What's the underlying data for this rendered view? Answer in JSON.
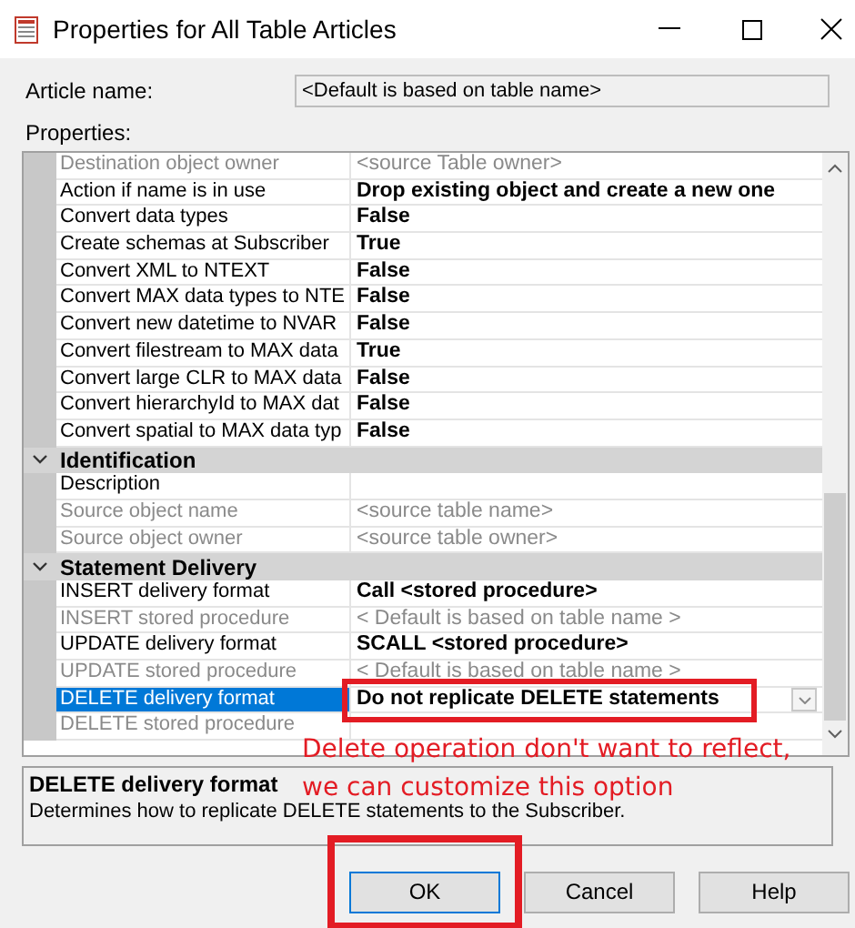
{
  "window": {
    "title": "Properties for All Table Articles"
  },
  "article_name": {
    "label": "Article name:",
    "value": "<Default is based on table name>"
  },
  "properties_label": "Properties:",
  "grid": {
    "rows": [
      {
        "kind": "property",
        "name": "Destination object owner",
        "value": "<source Table owner>",
        "readonly": true,
        "modified": false,
        "selected": false,
        "highlighted": false
      },
      {
        "kind": "property",
        "name": "Action if name is in use",
        "value": "Drop existing object and create a new one",
        "readonly": false,
        "modified": true,
        "selected": false,
        "highlighted": false
      },
      {
        "kind": "property",
        "name": "Convert data types",
        "value": "False",
        "readonly": false,
        "modified": true,
        "selected": false,
        "highlighted": false
      },
      {
        "kind": "property",
        "name": "Create schemas at Subscriber",
        "value": "True",
        "readonly": false,
        "modified": true,
        "selected": false,
        "highlighted": false
      },
      {
        "kind": "property",
        "name": "Convert XML to NTEXT",
        "value": "False",
        "readonly": false,
        "modified": true,
        "selected": false,
        "highlighted": false
      },
      {
        "kind": "property",
        "name": "Convert MAX data types to NTE",
        "value": "False",
        "readonly": false,
        "modified": true,
        "selected": false,
        "highlighted": false
      },
      {
        "kind": "property",
        "name": "Convert new datetime to NVAR",
        "value": "False",
        "readonly": false,
        "modified": true,
        "selected": false,
        "highlighted": false
      },
      {
        "kind": "property",
        "name": "Convert filestream to MAX data",
        "value": "True",
        "readonly": false,
        "modified": true,
        "selected": false,
        "highlighted": false
      },
      {
        "kind": "property",
        "name": "Convert large CLR to MAX data",
        "value": "False",
        "readonly": false,
        "modified": true,
        "selected": false,
        "highlighted": false
      },
      {
        "kind": "property",
        "name": "Convert hierarchyId to MAX dat",
        "value": "False",
        "readonly": false,
        "modified": true,
        "selected": false,
        "highlighted": false
      },
      {
        "kind": "property",
        "name": "Convert spatial to MAX data typ",
        "value": "False",
        "readonly": false,
        "modified": true,
        "selected": false,
        "highlighted": false
      },
      {
        "kind": "category",
        "label": "Identification",
        "expanded": true
      },
      {
        "kind": "property",
        "name": "Description",
        "readonly": false,
        "selected": false,
        "highlighted": false
      },
      {
        "kind": "property",
        "name": "Source object name",
        "value": "<source table name>",
        "readonly": true,
        "modified": false,
        "selected": false,
        "highlighted": false
      },
      {
        "kind": "property",
        "name": "Source object owner",
        "value": "<source table owner>",
        "readonly": true,
        "modified": false,
        "selected": false,
        "highlighted": false
      },
      {
        "kind": "category",
        "label": "Statement Delivery",
        "expanded": true
      },
      {
        "kind": "property",
        "name": "INSERT delivery format",
        "value": "Call <stored procedure>",
        "readonly": false,
        "modified": true,
        "selected": false,
        "highlighted": false
      },
      {
        "kind": "property",
        "name": "INSERT stored procedure",
        "value": "< Default is based on table name >",
        "readonly": true,
        "modified": false,
        "selected": false,
        "highlighted": false
      },
      {
        "kind": "property",
        "name": "UPDATE delivery format",
        "value": "SCALL <stored procedure>",
        "readonly": false,
        "modified": true,
        "selected": false,
        "highlighted": false
      },
      {
        "kind": "property",
        "name": "UPDATE stored procedure",
        "value": "< Default is based on table name >",
        "readonly": true,
        "modified": false,
        "selected": false,
        "highlighted": false
      },
      {
        "kind": "property",
        "name": "DELETE delivery format",
        "value": "Do not replicate DELETE statements",
        "readonly": false,
        "modified": true,
        "selected": true,
        "highlighted": true
      },
      {
        "kind": "property",
        "name": "DELETE stored procedure",
        "readonly": true,
        "selected": false,
        "highlighted": false
      }
    ]
  },
  "description": {
    "title": "DELETE delivery format",
    "text": "Determines how to replicate DELETE statements to the Subscriber."
  },
  "annotations": [
    "Delete operation don't want to reflect,",
    "we can customize this option"
  ],
  "buttons": [
    {
      "label": "OK",
      "default": true,
      "highlighted": true
    },
    {
      "label": "Cancel",
      "default": false,
      "highlighted": false
    },
    {
      "label": "Help",
      "default": false,
      "highlighted": false
    }
  ]
}
